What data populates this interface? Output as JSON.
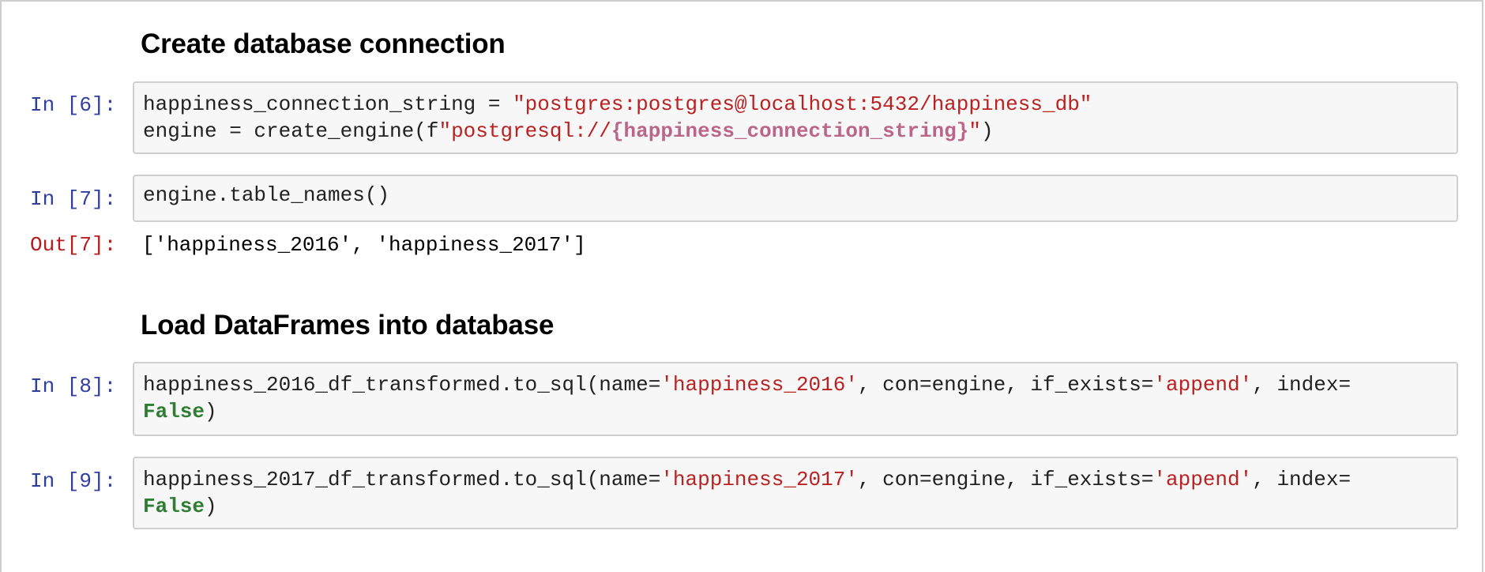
{
  "headings": {
    "h1": "Create database connection",
    "h2": "Load DataFrames into database"
  },
  "cells": {
    "c6": {
      "prompt": "In [6]:",
      "line1": {
        "a": "happiness_connection_string = ",
        "b": "\"postgres:postgres@localhost:5432/happiness_db\""
      },
      "line2": {
        "a": "engine = create_engine(f",
        "b": "\"postgresql://",
        "c": "{happiness_connection_string}",
        "d": "\"",
        "e": ")"
      }
    },
    "c7": {
      "prompt": "In [7]:",
      "line1": "engine.table_names()",
      "out_prompt": "Out[7]:",
      "output": "['happiness_2016', 'happiness_2017']"
    },
    "c8": {
      "prompt": "In [8]:",
      "line1": {
        "a": "happiness_2016_df_transformed.to_sql(name=",
        "b": "'happiness_2016'",
        "c": ", con=engine, if_exists=",
        "d": "'append'",
        "e": ", index="
      },
      "line2": {
        "kw": "False",
        "end": ")"
      }
    },
    "c9": {
      "prompt": "In [9]:",
      "line1": {
        "a": "happiness_2017_df_transformed.to_sql(name=",
        "b": "'happiness_2017'",
        "c": ", con=engine, if_exists=",
        "d": "'append'",
        "e": ", index="
      },
      "line2": {
        "kw": "False",
        "end": ")"
      }
    }
  }
}
